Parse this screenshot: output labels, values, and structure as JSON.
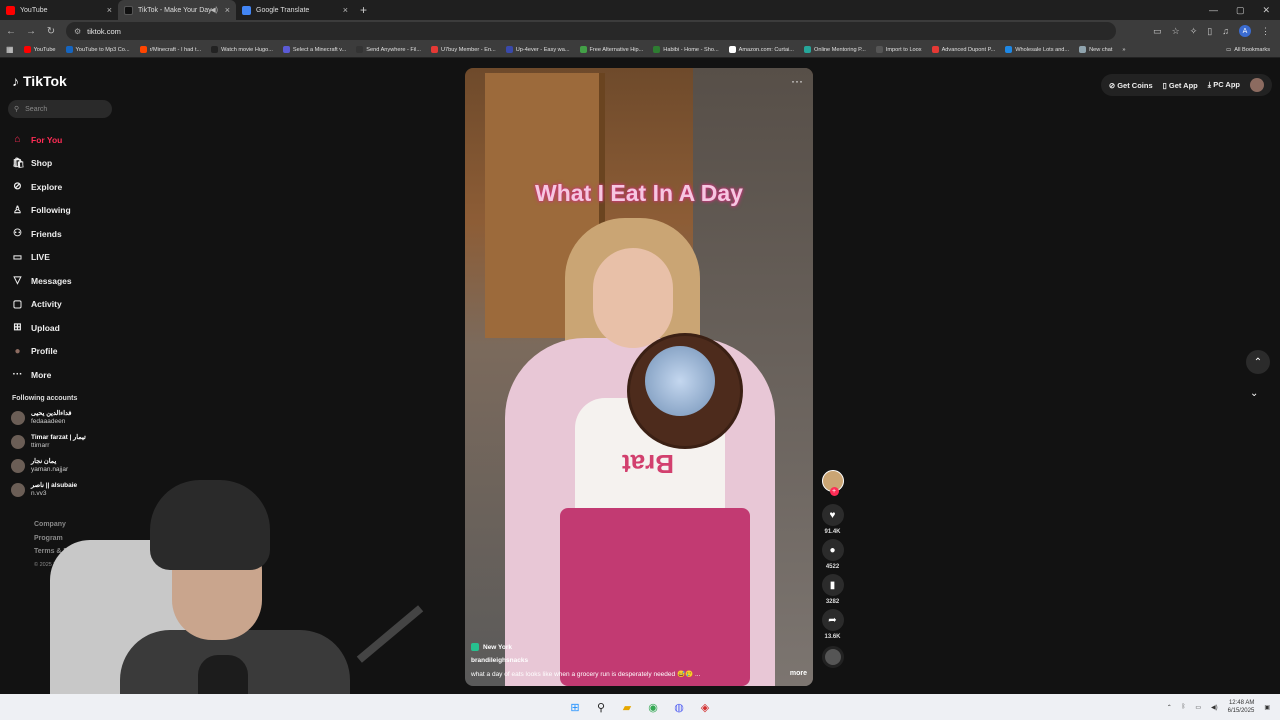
{
  "browser": {
    "tabs": [
      {
        "title": "YouTube",
        "color": "#ff0000"
      },
      {
        "title": "TikTok - Make Your Day",
        "color": "#111111"
      },
      {
        "title": "Google Translate",
        "color": "#4285f4"
      }
    ],
    "url": "tiktok.com",
    "profile_initial": "A",
    "bookmarks": [
      {
        "label": "YouTube",
        "color": "#ff0000"
      },
      {
        "label": "YouTube to Mp3 Co...",
        "color": "#1565c0"
      },
      {
        "label": "r/Minecraft - I had t...",
        "color": "#ff4500"
      },
      {
        "label": "Watch movie Hugo...",
        "color": "#222222"
      },
      {
        "label": "Select a Minecraft v...",
        "color": "#5b5bd6"
      },
      {
        "label": "Send Anywhere - Fil...",
        "color": "#333333"
      },
      {
        "label": "U7buy Member - En...",
        "color": "#e53935"
      },
      {
        "label": "Up-4ever - Easy wa...",
        "color": "#3949ab"
      },
      {
        "label": "Free Alternative Hip...",
        "color": "#43a047"
      },
      {
        "label": "Habibi - Home - Sho...",
        "color": "#2e7d32"
      },
      {
        "label": "Amazon.com: Curtai...",
        "color": "#ffffff"
      },
      {
        "label": "Online Mentoring P...",
        "color": "#26a69a"
      },
      {
        "label": "Import to Loox",
        "color": "#555555"
      },
      {
        "label": "Advanced Dupont P...",
        "color": "#e53935"
      },
      {
        "label": "Wholesale Lots and...",
        "color": "#1e88e5"
      },
      {
        "label": "New chat",
        "color": "#90a4ae"
      }
    ],
    "all_bookmarks": "All Bookmarks"
  },
  "tiktok": {
    "logo": "TikTok",
    "search_placeholder": "Search",
    "nav": [
      {
        "label": "For You",
        "icon": "home-icon",
        "glyph": "⌂"
      },
      {
        "label": "Shop",
        "icon": "shop-icon",
        "glyph": "🛍"
      },
      {
        "label": "Explore",
        "icon": "compass-icon",
        "glyph": "⊘"
      },
      {
        "label": "Following",
        "icon": "person-icon",
        "glyph": "♙"
      },
      {
        "label": "Friends",
        "icon": "friends-icon",
        "glyph": "⚇"
      },
      {
        "label": "LIVE",
        "icon": "live-icon",
        "glyph": "▭"
      },
      {
        "label": "Messages",
        "icon": "messages-icon",
        "glyph": "▽"
      },
      {
        "label": "Activity",
        "icon": "activity-icon",
        "glyph": "▢"
      },
      {
        "label": "Upload",
        "icon": "upload-icon",
        "glyph": "⊞"
      },
      {
        "label": "Profile",
        "icon": "profile-avatar-icon",
        "glyph": "●"
      },
      {
        "label": "More",
        "icon": "more-icon",
        "glyph": "···"
      }
    ],
    "following_title": "Following accounts",
    "accounts": [
      {
        "name": "فداءالدين يحيى",
        "handle": "fedaaadeen"
      },
      {
        "name": "Timar farzat | تيمار",
        "handle": "ttimarr"
      },
      {
        "name": "يمان نجار",
        "handle": "yaman.najjar"
      },
      {
        "name": "ناصر || alsubaie ‪ ‪",
        "handle": "n.vv3"
      }
    ],
    "footer": [
      "Company",
      "Program",
      "Terms & Policies"
    ],
    "copyright": "© 2025 TikTok",
    "top_right": {
      "coins": "Get Coins",
      "app": "Get App",
      "pc": "PC App"
    },
    "video": {
      "overlay": "What I Eat In A Day",
      "shirt_text": "Brat",
      "location": "New York",
      "author": "brandileighsnacks",
      "caption": "what a day of eats looks like when a grocery run is desperately needed 😅🥲 ...",
      "more": "more",
      "likes": "91.4K",
      "comments": "4522",
      "saves": "3282",
      "shares": "13.6K"
    }
  },
  "taskbar": {
    "time": "12:48 AM",
    "date": "6/15/2025"
  }
}
